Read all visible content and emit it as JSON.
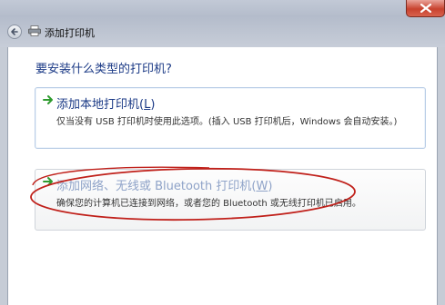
{
  "window": {
    "title": "添加打印机",
    "close_icon": "close-icon",
    "back_icon": "back-arrow-icon",
    "printer_icon": "printer-icon"
  },
  "content": {
    "question": "要安装什么类型的打印机?",
    "options": [
      {
        "title_prefix": "添加本地打印机(",
        "accel": "L",
        "title_suffix": ")",
        "description": "仅当没有 USB 打印机时使用此选项。(插入 USB 打印机后，Windows 会自动安装。)",
        "icon": "green-arrow-icon"
      },
      {
        "title_prefix": "添加网络、无线或 Bluetooth 打印机(",
        "accel": "W",
        "title_suffix": ")",
        "description": "确保您的计算机已连接到网络，或者您的 Bluetooth 或无线打印机已启用。",
        "icon": "green-arrow-icon"
      }
    ]
  },
  "colors": {
    "accent_text": "#1b3a86",
    "annotation_red": "#c0201a",
    "arrow_green": "#2e9b2e"
  }
}
